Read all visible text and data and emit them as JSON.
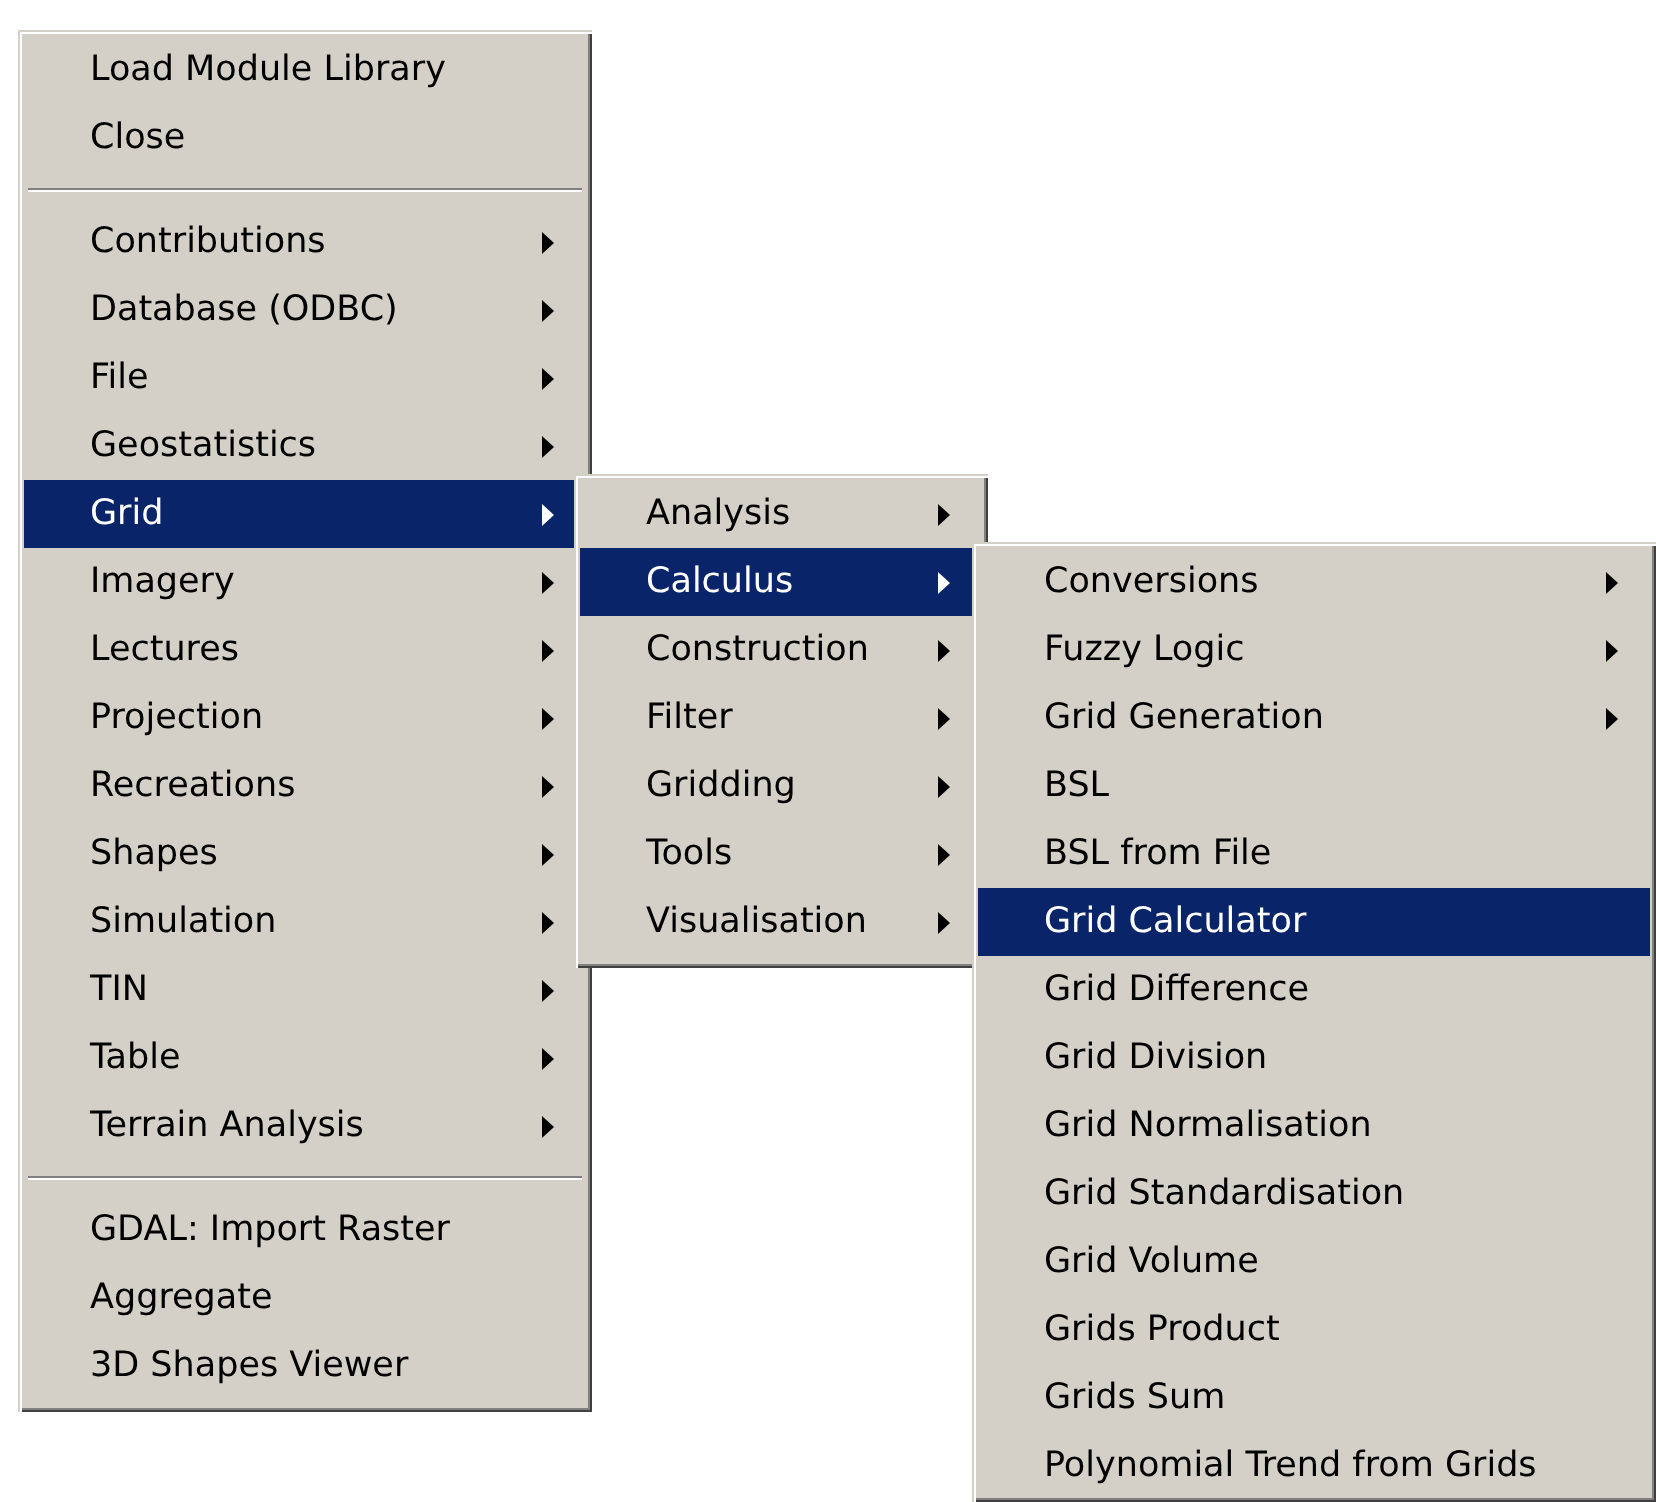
{
  "menus": [
    {
      "items": [
        {
          "kind": "item",
          "label": "Load Module Library",
          "submenu": false,
          "selected": false
        },
        {
          "kind": "item",
          "label": "Close",
          "submenu": false,
          "selected": false
        },
        {
          "kind": "separator"
        },
        {
          "kind": "item",
          "label": "Contributions",
          "submenu": true,
          "selected": false
        },
        {
          "kind": "item",
          "label": "Database (ODBC)",
          "submenu": true,
          "selected": false
        },
        {
          "kind": "item",
          "label": "File",
          "submenu": true,
          "selected": false
        },
        {
          "kind": "item",
          "label": "Geostatistics",
          "submenu": true,
          "selected": false
        },
        {
          "kind": "item",
          "label": "Grid",
          "submenu": true,
          "selected": true
        },
        {
          "kind": "item",
          "label": "Imagery",
          "submenu": true,
          "selected": false
        },
        {
          "kind": "item",
          "label": "Lectures",
          "submenu": true,
          "selected": false
        },
        {
          "kind": "item",
          "label": "Projection",
          "submenu": true,
          "selected": false
        },
        {
          "kind": "item",
          "label": "Recreations",
          "submenu": true,
          "selected": false
        },
        {
          "kind": "item",
          "label": "Shapes",
          "submenu": true,
          "selected": false
        },
        {
          "kind": "item",
          "label": "Simulation",
          "submenu": true,
          "selected": false
        },
        {
          "kind": "item",
          "label": "TIN",
          "submenu": true,
          "selected": false
        },
        {
          "kind": "item",
          "label": "Table",
          "submenu": true,
          "selected": false
        },
        {
          "kind": "item",
          "label": "Terrain Analysis",
          "submenu": true,
          "selected": false
        },
        {
          "kind": "separator"
        },
        {
          "kind": "item",
          "label": "GDAL: Import Raster",
          "submenu": false,
          "selected": false
        },
        {
          "kind": "item",
          "label": "Aggregate",
          "submenu": false,
          "selected": false
        },
        {
          "kind": "item",
          "label": "3D Shapes Viewer",
          "submenu": false,
          "selected": false
        }
      ]
    },
    {
      "items": [
        {
          "kind": "item",
          "label": "Analysis",
          "submenu": true,
          "selected": false
        },
        {
          "kind": "item",
          "label": "Calculus",
          "submenu": true,
          "selected": true
        },
        {
          "kind": "item",
          "label": "Construction",
          "submenu": true,
          "selected": false
        },
        {
          "kind": "item",
          "label": "Filter",
          "submenu": true,
          "selected": false
        },
        {
          "kind": "item",
          "label": "Gridding",
          "submenu": true,
          "selected": false
        },
        {
          "kind": "item",
          "label": "Tools",
          "submenu": true,
          "selected": false
        },
        {
          "kind": "item",
          "label": "Visualisation",
          "submenu": true,
          "selected": false
        }
      ]
    },
    {
      "items": [
        {
          "kind": "item",
          "label": "Conversions",
          "submenu": true,
          "selected": false
        },
        {
          "kind": "item",
          "label": "Fuzzy Logic",
          "submenu": true,
          "selected": false
        },
        {
          "kind": "item",
          "label": "Grid Generation",
          "submenu": true,
          "selected": false
        },
        {
          "kind": "item",
          "label": "BSL",
          "submenu": false,
          "selected": false
        },
        {
          "kind": "item",
          "label": "BSL from File",
          "submenu": false,
          "selected": false
        },
        {
          "kind": "item",
          "label": "Grid Calculator",
          "submenu": false,
          "selected": true
        },
        {
          "kind": "item",
          "label": "Grid Difference",
          "submenu": false,
          "selected": false
        },
        {
          "kind": "item",
          "label": "Grid Division",
          "submenu": false,
          "selected": false
        },
        {
          "kind": "item",
          "label": "Grid Normalisation",
          "submenu": false,
          "selected": false
        },
        {
          "kind": "item",
          "label": "Grid Standardisation",
          "submenu": false,
          "selected": false
        },
        {
          "kind": "item",
          "label": "Grid Volume",
          "submenu": false,
          "selected": false
        },
        {
          "kind": "item",
          "label": "Grids Product",
          "submenu": false,
          "selected": false
        },
        {
          "kind": "item",
          "label": "Grids Sum",
          "submenu": false,
          "selected": false
        },
        {
          "kind": "item",
          "label": "Polynomial Trend from Grids",
          "submenu": false,
          "selected": false
        }
      ]
    }
  ]
}
